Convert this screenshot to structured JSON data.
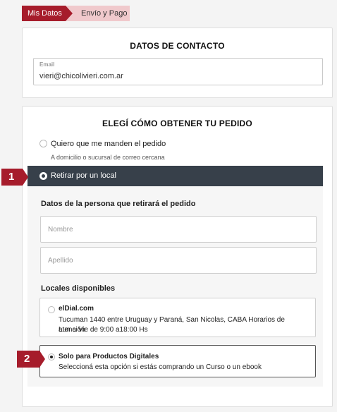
{
  "breadcrumb": {
    "step1": "Mis Datos",
    "step2": "Envío y Pago"
  },
  "contact": {
    "title": "DATOS DE CONTACTO",
    "email_label": "Email",
    "email_value": "vieri@chicolivieri.com.ar"
  },
  "order": {
    "title": "ELEGÍ CÓMO OBTENER TU PEDIDO",
    "ship_option": {
      "label": "Quiero que me manden el pedido",
      "sub": "A domicilio o sucursal de correo cercana"
    },
    "pickup_option": {
      "label": "Retirar por un local"
    },
    "person_section_label": "Datos de la persona que retirará el pedido",
    "name_placeholder": "Nombre",
    "surname_placeholder": "Apellido",
    "locales_label": "Locales disponibles",
    "locales": [
      {
        "name": "elDial.com",
        "address": "Tucuman 1440 entre Uruguay y Paraná, San Nicolas, CABA Horarios de atención",
        "hours": "Lun a Vie de 9:00 a18:00 Hs"
      },
      {
        "name": "Solo para Productos Digitales",
        "address": "Seleccioná esta opción si estás comprando un Curso o un ebook"
      }
    ]
  },
  "callouts": {
    "one": "1",
    "two": "2"
  },
  "colors": {
    "accent": "#a61c2b",
    "accent_light": "#f0c9cc",
    "selected_bar": "#37404a"
  }
}
